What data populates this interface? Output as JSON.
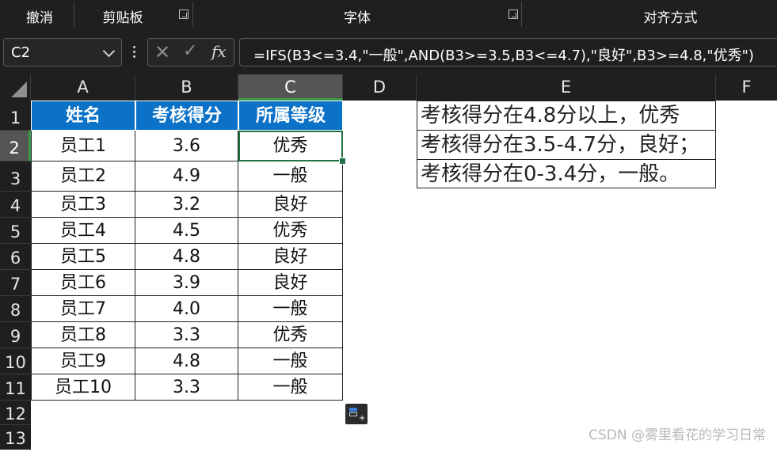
{
  "ribbon": {
    "undo_label": "撤消",
    "clipboard_label": "剪贴板",
    "font_label": "字体",
    "alignment_label": "对齐方式"
  },
  "formula_bar": {
    "name_box": "C2",
    "formula": "=IFS(B3<=3.4,\"一般\",AND(B3>=3.5,B3<=4.7),\"良好\",B3>=4.8,\"优秀\")",
    "cancel_icon": "✕",
    "enter_icon": "✓",
    "fx_label": "fx"
  },
  "columns": [
    "A",
    "B",
    "C",
    "D",
    "E",
    "F"
  ],
  "rows": [
    "1",
    "2",
    "3",
    "4",
    "5",
    "6",
    "7",
    "8",
    "9",
    "10",
    "11",
    "12",
    "13"
  ],
  "table": {
    "headers": [
      "姓名",
      "考核得分",
      "所属等级"
    ],
    "rows": [
      [
        "员工1",
        "3.6",
        "优秀"
      ],
      [
        "员工2",
        "4.9",
        "一般"
      ],
      [
        "员工3",
        "3.2",
        "良好"
      ],
      [
        "员工4",
        "4.5",
        "优秀"
      ],
      [
        "员工5",
        "4.8",
        "良好"
      ],
      [
        "员工6",
        "3.9",
        "良好"
      ],
      [
        "员工7",
        "4.0",
        "一般"
      ],
      [
        "员工8",
        "3.3",
        "优秀"
      ],
      [
        "员工9",
        "4.8",
        "一般"
      ],
      [
        "员工10",
        "3.3",
        "一般"
      ]
    ]
  },
  "notes": [
    "考核得分在4.8分以上，优秀",
    "考核得分在3.5-4.7分，良好；",
    "考核得分在0-3.4分，一般。"
  ],
  "watermark": "CSDN @雾里看花的学习日常",
  "colors": {
    "header_fill": "#0b72c7",
    "selection_border": "#217346",
    "dark_chrome": "#1f1f1f"
  }
}
